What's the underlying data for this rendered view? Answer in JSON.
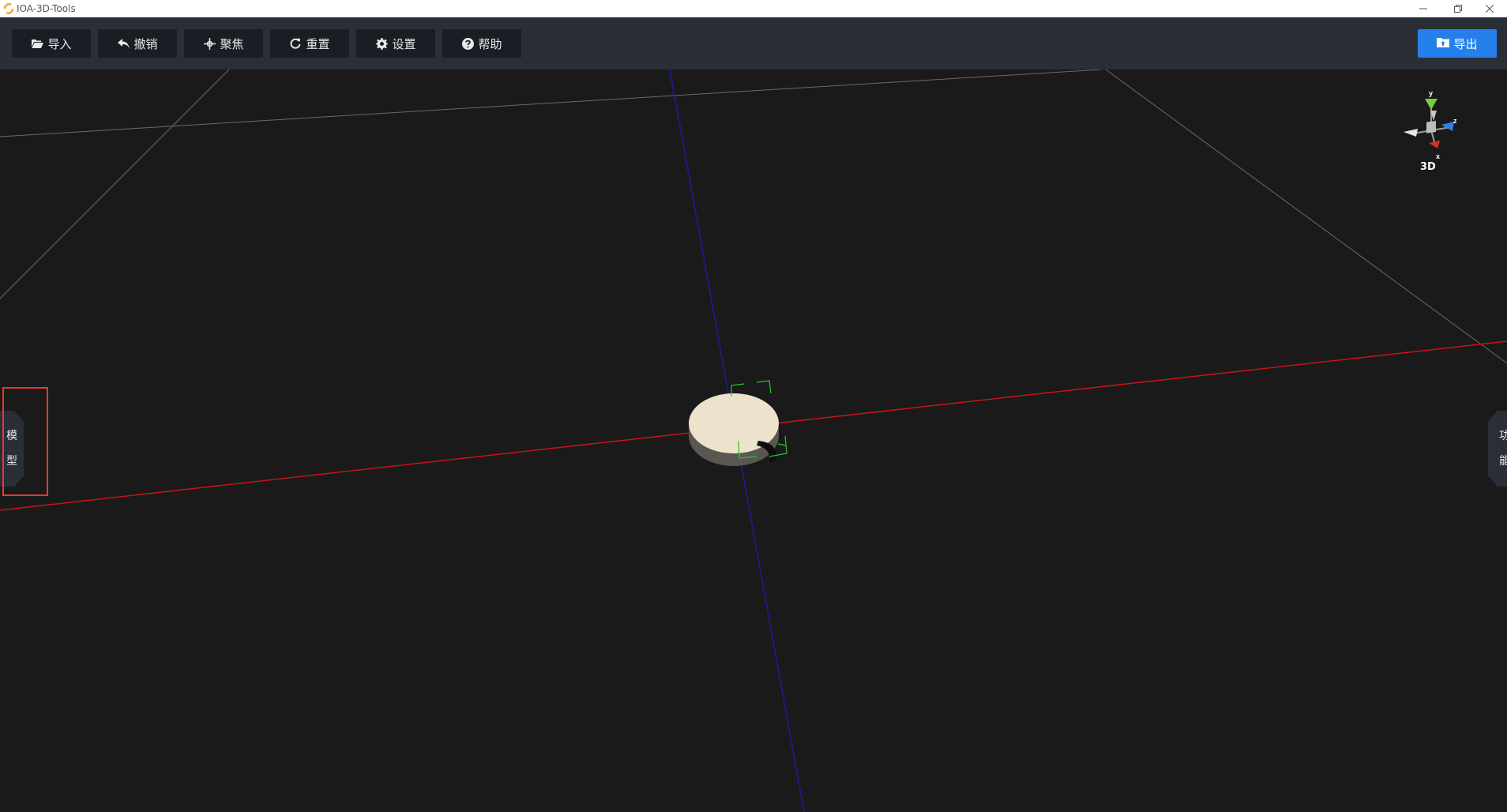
{
  "window": {
    "title": "IOA-3D-Tools"
  },
  "toolbar": {
    "buttons": [
      {
        "label": "导入",
        "icon": "folder-open-icon"
      },
      {
        "label": "撤销",
        "icon": "undo-icon"
      },
      {
        "label": "聚焦",
        "icon": "crosshair-icon"
      },
      {
        "label": "重置",
        "icon": "refresh-icon"
      },
      {
        "label": "设置",
        "icon": "gear-icon"
      },
      {
        "label": "帮助",
        "icon": "question-circle-icon"
      }
    ],
    "export_label": "导出",
    "export_icon": "export-folder-icon"
  },
  "side_panels": {
    "left_chars": [
      "模",
      "型"
    ],
    "right_chars": [
      "功",
      "能"
    ]
  },
  "gizmo": {
    "mode_label": "3D",
    "axis_y": "y",
    "axis_z": "z",
    "axis_x": "x"
  },
  "colors": {
    "accent": "#2680eb",
    "toolbar_bg": "#2a2e37",
    "button_bg": "#1a1d24",
    "viewport_bg": "#1a1a1a",
    "x_axis": "#c81414",
    "z_axis": "#1a1aa0",
    "grid": "#6a6a6a",
    "model": "#ede3cc",
    "selection": "#22cc22",
    "highlight": "#e53935"
  }
}
